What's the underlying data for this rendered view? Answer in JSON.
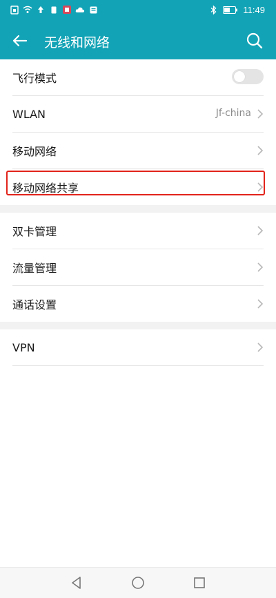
{
  "status_bar": {
    "time": "11:49",
    "icons_left": [
      "sim-icon",
      "wifi-icon",
      "upload-icon",
      "notification-icon",
      "app-icon",
      "cloud-icon",
      "mail-icon"
    ],
    "icons_right": [
      "bluetooth-icon",
      "battery-icon"
    ]
  },
  "app_bar": {
    "title": "无线和网络",
    "back_icon": "back-arrow-icon",
    "search_icon": "search-icon"
  },
  "sections": [
    {
      "items": [
        {
          "label": "飞行模式",
          "type": "toggle",
          "state": "off"
        },
        {
          "label": "WLAN",
          "value": "Jf-china",
          "type": "link"
        },
        {
          "label": "移动网络",
          "type": "link"
        },
        {
          "label": "移动网络共享",
          "type": "link",
          "highlighted": true
        }
      ]
    },
    {
      "items": [
        {
          "label": "双卡管理",
          "type": "link"
        },
        {
          "label": "流量管理",
          "type": "link"
        },
        {
          "label": "通话设置",
          "type": "link"
        }
      ]
    },
    {
      "items": [
        {
          "label": "VPN",
          "type": "link"
        }
      ]
    }
  ],
  "colors": {
    "accent": "#13a3b6",
    "highlight_border": "#e2231a"
  },
  "nav_bar": {
    "buttons": [
      "back-triangle-icon",
      "home-circle-icon",
      "recents-square-icon"
    ]
  }
}
